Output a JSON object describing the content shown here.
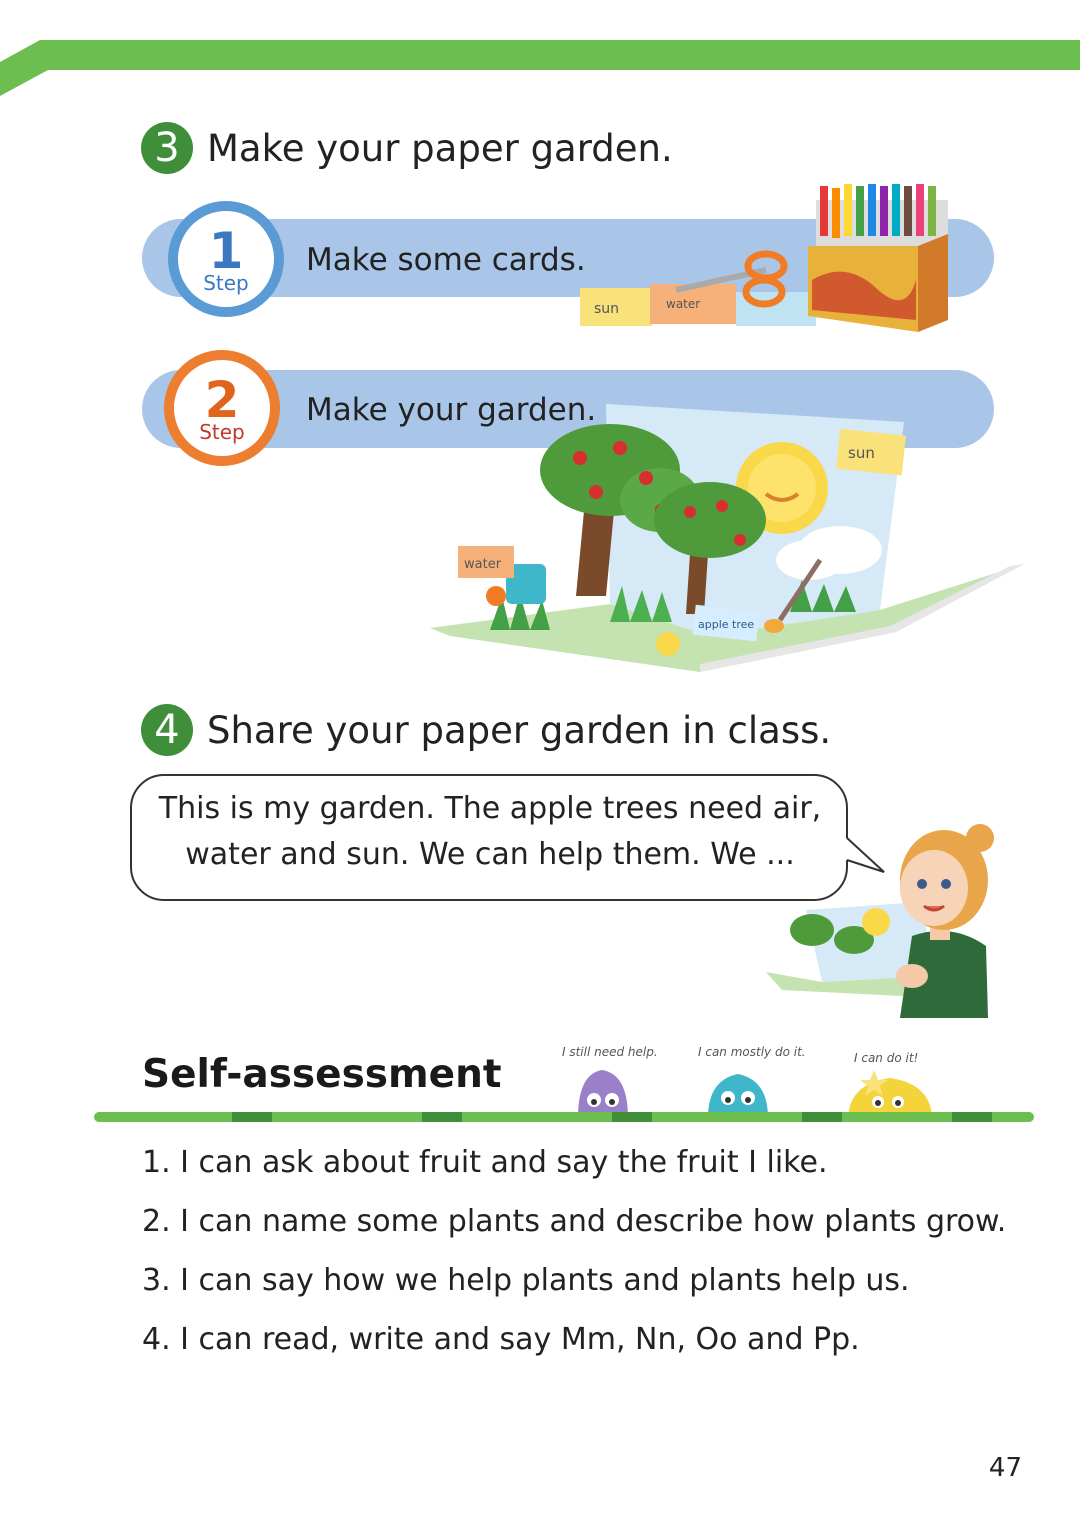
{
  "section3": {
    "number": "3",
    "title": "Make your paper garden."
  },
  "steps": [
    {
      "number": "1",
      "word": "Step",
      "text": "Make some cards.",
      "color": "#5b9bd5"
    },
    {
      "number": "2",
      "word": "Step",
      "text": "Make your garden.",
      "color": "#ed7d31"
    }
  ],
  "cards": {
    "sun": "sun",
    "water": "water",
    "apple_tree": "apple tree"
  },
  "section4": {
    "number": "4",
    "title": "Share your paper garden in class."
  },
  "speech": {
    "line1": "This is my garden. The apple trees need air,",
    "line2": "water and sun. We can help them. We ..."
  },
  "self_assessment": {
    "title": "Self-assessment",
    "badges": [
      {
        "label": "I still need help.",
        "icon": "purple-monster-icon",
        "color": "#9b7fc8"
      },
      {
        "label": "I can mostly do it.",
        "icon": "teal-monster-icon",
        "color": "#3fb6c9"
      },
      {
        "label": "I can do it!",
        "icon": "yellow-star-monster-icon",
        "color": "#f5d33a"
      }
    ],
    "items": [
      "1. I can ask about fruit and say the fruit I like.",
      "2. I can name some plants and describe how plants grow.",
      "3. I can say how we help plants and plants help us.",
      "4. I can read, write and say Mm, Nn, Oo and Pp."
    ]
  },
  "page_number": "47",
  "colors": {
    "green": "#6cbe4f",
    "dark_green": "#3f8f3a",
    "band_blue": "#a9c6e8"
  }
}
